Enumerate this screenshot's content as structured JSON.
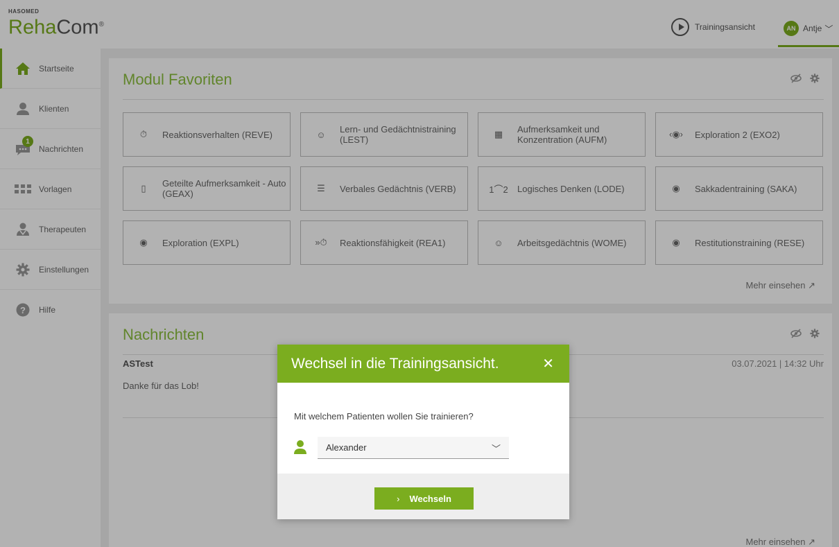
{
  "header": {
    "brand_small": "HASOMED",
    "brand_reha": "Reha",
    "brand_com": "Com",
    "brand_mark": "®",
    "training_view_label": "Trainingsansicht",
    "user_initials": "AN",
    "user_name": "Antje"
  },
  "sidebar": {
    "items": [
      {
        "label": "Startseite",
        "icon": "home-icon"
      },
      {
        "label": "Klienten",
        "icon": "user-icon"
      },
      {
        "label": "Nachrichten",
        "icon": "chat-icon",
        "badge": "1"
      },
      {
        "label": "Vorlagen",
        "icon": "grid-icon"
      },
      {
        "label": "Therapeuten",
        "icon": "therapist-icon"
      },
      {
        "label": "Einstellungen",
        "icon": "gear-icon"
      },
      {
        "label": "Hilfe",
        "icon": "help-icon"
      }
    ]
  },
  "favorites": {
    "title": "Modul Favoriten",
    "more_label": "Mehr einsehen ↗",
    "tiles": [
      {
        "label": "Reaktionsverhalten (REVE)",
        "icon": "reaction-timer-icon"
      },
      {
        "label": "Lern- und Gedächtnistraining (LEST)",
        "icon": "head-brain-icon"
      },
      {
        "label": "Aufmerksamkeit und Konzentration (AUFM)",
        "icon": "attention-grid-icon"
      },
      {
        "label": "Exploration 2 (EXO2)",
        "icon": "exploration-eye-icon"
      },
      {
        "label": "Geteilte Aufmerksamkeit - Auto (GEAX)",
        "icon": "car-split-icon"
      },
      {
        "label": "Verbales Gedächtnis (VERB)",
        "icon": "head-text-icon"
      },
      {
        "label": "Logisches Denken (LODE)",
        "icon": "logic-sequence-icon"
      },
      {
        "label": "Sakkadentraining (SAKA)",
        "icon": "saccade-eye-icon"
      },
      {
        "label": "Exploration (EXPL)",
        "icon": "exploration-lines-eye-icon"
      },
      {
        "label": "Reaktionsfähigkeit (REA1)",
        "icon": "fast-timer-icon"
      },
      {
        "label": "Arbeitsgedächtnis (WOME)",
        "icon": "head-memory-icon"
      },
      {
        "label": "Restitutionstraining (RESE)",
        "icon": "restitution-eye-icon"
      }
    ]
  },
  "messages": {
    "title": "Nachrichten",
    "sender": "ASTest",
    "date": "03.07.2021 | 14:32 Uhr",
    "text": "Danke für das Lob!",
    "more_label": "Mehr einsehen ↗"
  },
  "dialog": {
    "title": "Wechsel in die Trainingsansicht.",
    "close": "✕",
    "question": "Mit welchem Patienten wollen Sie trainieren?",
    "selected_patient": "Alexander",
    "button_label": "Wechseln",
    "button_arrow": "›"
  },
  "colors": {
    "accent": "#7bad1f",
    "title_green": "#8cbf3f"
  }
}
